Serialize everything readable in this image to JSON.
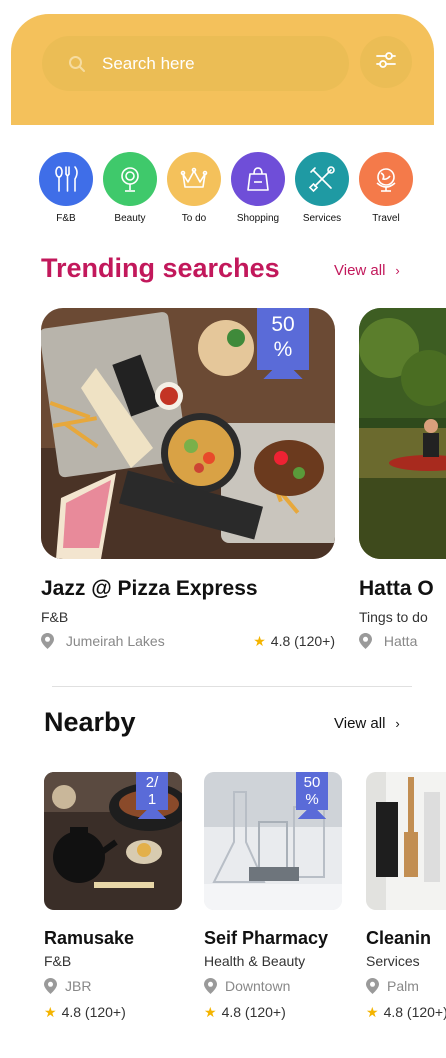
{
  "search": {
    "placeholder": "Search here"
  },
  "categories": [
    {
      "label": "F&B",
      "color": "#3f6ee8",
      "icon": "fork-knife-icon"
    },
    {
      "label": "Beauty",
      "color": "#3fc96b",
      "icon": "mirror-icon"
    },
    {
      "label": "To do",
      "color": "#f4c15b",
      "icon": "crown-icon"
    },
    {
      "label": "Shopping",
      "color": "#6f4ed8",
      "icon": "shopping-bag-icon"
    },
    {
      "label": "Services",
      "color": "#1f9aa3",
      "icon": "tools-icon"
    },
    {
      "label": "Travel",
      "color": "#f47a4a",
      "icon": "globe-icon"
    }
  ],
  "trending": {
    "title": "Trending searches",
    "view_all": "View all",
    "items": [
      {
        "name": "Jazz @ Pizza Express",
        "category": "F&B",
        "location": "Jumeirah Lakes",
        "rating": "4.8 (120+)",
        "badge_top": "50",
        "badge_bottom": "%"
      },
      {
        "name": "Hatta O",
        "category": "Tings to do",
        "location": "Hatta"
      }
    ]
  },
  "nearby": {
    "title": "Nearby",
    "view_all": "View all",
    "items": [
      {
        "name": "Ramusake",
        "category": "F&B",
        "location": "JBR",
        "rating": "4.8 (120+)",
        "badge_top": "2/",
        "badge_bottom": "1"
      },
      {
        "name": "Seif Pharmacy",
        "category": "Health & Beauty",
        "location": "Downtown",
        "rating": "4.8 (120+)",
        "badge_top": "50",
        "badge_bottom": "%"
      },
      {
        "name": "Cleanin",
        "category": "Services",
        "location": "Palm",
        "rating": "4.8 (120+)"
      }
    ]
  },
  "colors": {
    "header": "#f4c15b",
    "accent": "#c2185b",
    "badge": "#5a6bd8",
    "star": "#f4b400"
  }
}
